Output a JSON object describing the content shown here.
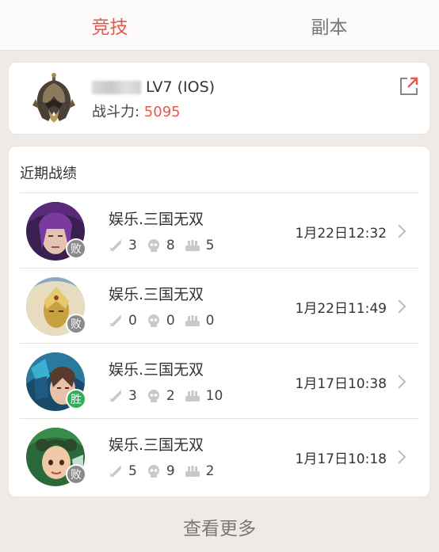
{
  "tabs": [
    {
      "label": "竞技",
      "active": true
    },
    {
      "label": "副本",
      "active": false
    }
  ],
  "profile": {
    "level": "LV7 (IOS)",
    "power_label": "战斗力: ",
    "power_value": "5095"
  },
  "records": {
    "title": "近期战绩",
    "items": [
      {
        "server": "娱乐.三国无双",
        "kills": "3",
        "deaths": "8",
        "assists": "5",
        "time": "1月22日12:32",
        "result": "败"
      },
      {
        "server": "娱乐.三国无双",
        "kills": "0",
        "deaths": "0",
        "assists": "0",
        "time": "1月22日11:49",
        "result": "败"
      },
      {
        "server": "娱乐.三国无双",
        "kills": "3",
        "deaths": "2",
        "assists": "10",
        "time": "1月17日10:38",
        "result": "胜"
      },
      {
        "server": "娱乐.三国无双",
        "kills": "5",
        "deaths": "9",
        "assists": "2",
        "time": "1月17日10:18",
        "result": "败"
      }
    ]
  },
  "footer": {
    "more_label": "查看更多"
  },
  "colors": {
    "accent": "#e8574c",
    "win": "#2fae5a",
    "lose": "#8a8a8a"
  }
}
